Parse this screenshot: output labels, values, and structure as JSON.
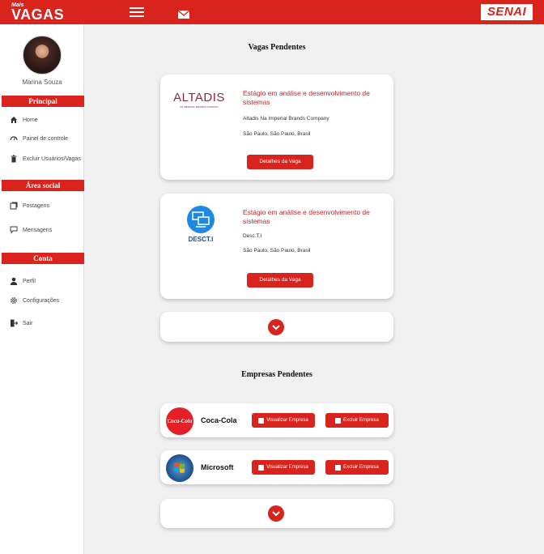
{
  "header": {
    "logo_small": "Mais",
    "logo_main": "VAGAS",
    "brand_right": "SENAI",
    "menu_icon": "hamburger-menu-icon",
    "mail_icon": "mail-icon"
  },
  "user": {
    "name": "Marina Souza"
  },
  "sidebar": {
    "sections": [
      {
        "title": "Principal",
        "items": [
          {
            "label": "Home",
            "icon": "home-icon"
          },
          {
            "label": "Painel de controle",
            "icon": "dashboard-icon"
          },
          {
            "label": "Excluir Usuários/Vagas",
            "icon": "trash-icon"
          }
        ]
      },
      {
        "title": "Área social",
        "items": [
          {
            "label": "Postagens",
            "icon": "posts-icon"
          },
          {
            "label": "Mensagens",
            "icon": "chat-icon"
          }
        ]
      },
      {
        "title": "Conta",
        "items": [
          {
            "label": "Perfil",
            "icon": "user-icon"
          },
          {
            "label": "Configurações",
            "icon": "gear-icon"
          },
          {
            "label": "Sair",
            "icon": "logout-icon"
          }
        ]
      }
    ]
  },
  "main": {
    "vagas_title": "Vagas Pendentes",
    "jobs": [
      {
        "logo_text": "ALTADIS",
        "logo_sub": "AN IMPERIAL BRANDS COMPANY",
        "title": "Estágio em análise e desenvolvimento de sistemas",
        "company": "Altadis Na Imperial Brands Company",
        "location": "São Paulo, São Paulo, Brasil",
        "button": "Detalhes da Vaga"
      },
      {
        "logo_text": "DESCT.I",
        "title": "Estágio em análise e desenvolvimento de sistemas",
        "company": "Desc.T.I",
        "location": "São Paulo, São Paulo, Brasil",
        "button": "Detalhes da Vaga"
      }
    ],
    "empresas_title": "Empresas Pendentes",
    "companies": [
      {
        "name": "Coca-Cola",
        "logo_text": "Coca-Cola",
        "view_button": "Visualizar Empresa",
        "delete_button": "Excluir Empresa"
      },
      {
        "name": "Microsoft",
        "view_button": "Visualizar Empresa",
        "delete_button": "Excluir Empresa"
      }
    ]
  },
  "colors": {
    "brand_red": "#d9231d",
    "title_red": "#c0262b",
    "background": "#f0f0f0"
  }
}
